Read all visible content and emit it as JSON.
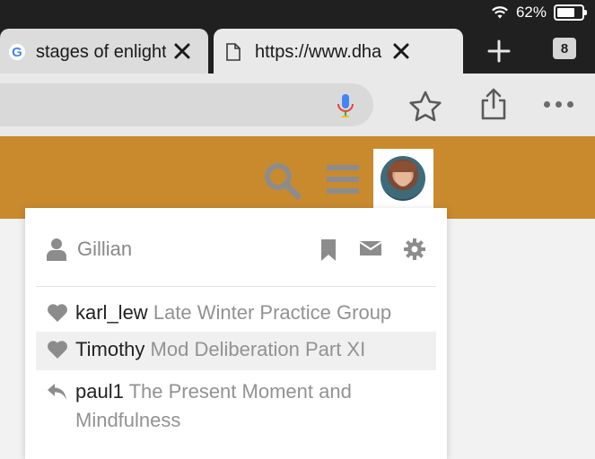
{
  "status_bar": {
    "battery_percent": "62%",
    "battery_level": 0.62,
    "icons": [
      "wifi-icon",
      "battery-icon"
    ]
  },
  "tabs": [
    {
      "title": "stages of enlight",
      "favicon": "google-icon",
      "active": false
    },
    {
      "title": "https://www.dha",
      "favicon": "document-icon",
      "active": true
    }
  ],
  "tab_count": "8",
  "toolbar": {
    "icons": [
      "mic-icon",
      "star-icon",
      "share-icon",
      "more-icon"
    ]
  },
  "site_header": {
    "color": "#c98a2e",
    "icons": [
      "search-icon",
      "hamburger-menu-icon",
      "avatar"
    ]
  },
  "user_menu": {
    "username": "Gillian",
    "actions": [
      "bookmark-icon",
      "mail-icon",
      "settings-icon"
    ],
    "notifications": [
      {
        "icon": "heart-icon",
        "user": "karl_lew",
        "text": "Late Winter Practice Group"
      },
      {
        "icon": "heart-icon",
        "user": "Timothy",
        "text": "Mod Deliberation Part XI"
      },
      {
        "icon": "reply-icon",
        "user": "paul1",
        "text": "The Present Moment and Mindfulness"
      }
    ]
  }
}
